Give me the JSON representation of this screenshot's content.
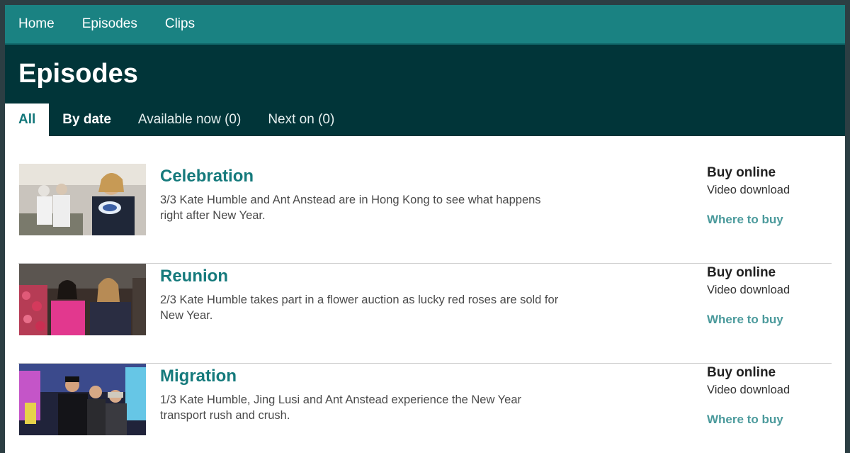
{
  "nav": {
    "items": [
      "Home",
      "Episodes",
      "Clips"
    ]
  },
  "header": {
    "title": "Episodes"
  },
  "tabs": [
    "All",
    "By date",
    "Available now (0)",
    "Next on (0)"
  ],
  "episodes": [
    {
      "title": "Celebration",
      "description": "3/3 Kate Humble and Ant Anstead are in Hong Kong to see what happens right after New Year.",
      "buy_title": "Buy online",
      "buy_sub": "Video download",
      "buy_link": "Where to buy"
    },
    {
      "title": "Reunion",
      "description": "2/3 Kate Humble takes part in a flower auction as lucky red roses are sold for New Year.",
      "buy_title": "Buy online",
      "buy_sub": "Video download",
      "buy_link": "Where to buy"
    },
    {
      "title": "Migration",
      "description": "1/3 Kate Humble, Jing Lusi and Ant Anstead experience the New Year transport rush and crush.",
      "buy_title": "Buy online",
      "buy_sub": "Video download",
      "buy_link": "Where to buy"
    }
  ],
  "colors": {
    "nav_bg": "#1a8282",
    "header_bg": "#013539",
    "title_teal": "#157a7c",
    "link_teal": "#4b9a9c"
  }
}
